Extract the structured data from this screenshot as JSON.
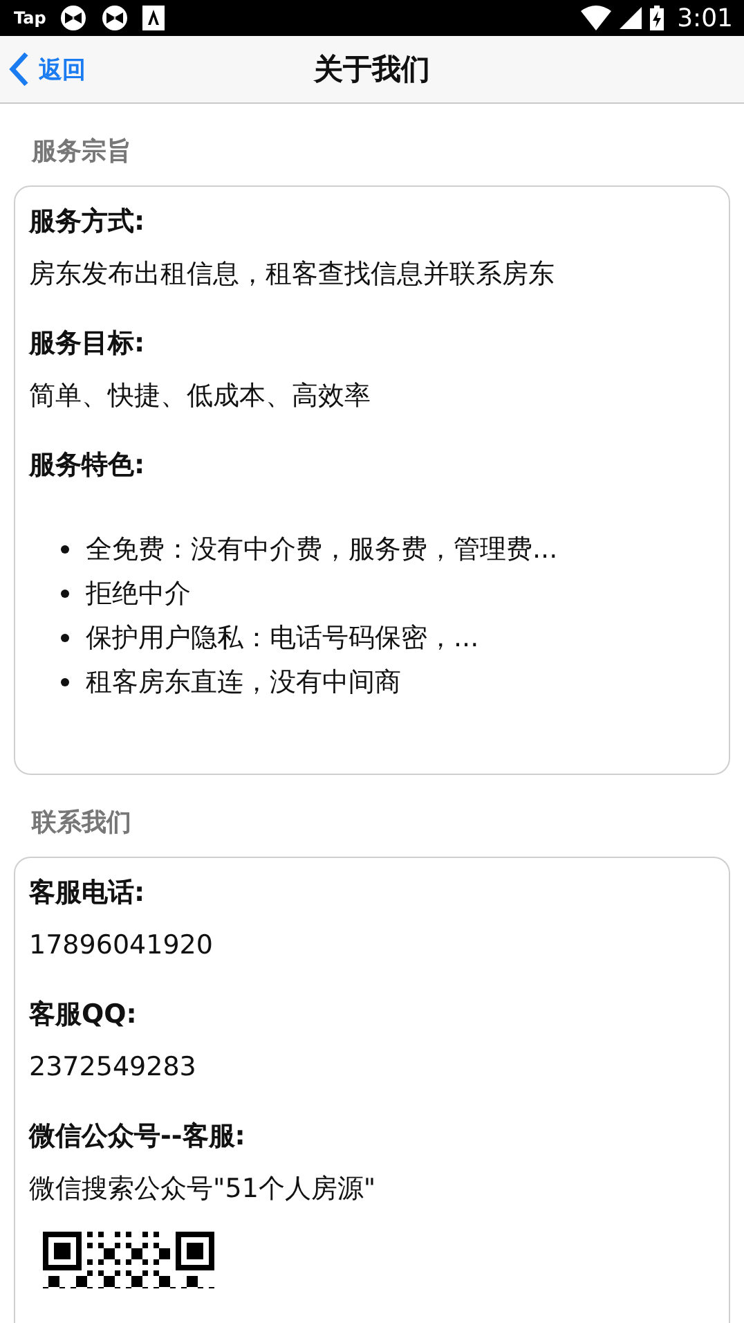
{
  "status_bar": {
    "app_label": "Tap",
    "time": "3:01"
  },
  "header": {
    "back": "返回",
    "title": "关于我们"
  },
  "sections": [
    {
      "title": "服务宗旨",
      "blocks": [
        {
          "kind": "text",
          "label": "服务方式:",
          "text": "房东发布出租信息，租客查找信息并联系房东"
        },
        {
          "kind": "text",
          "label": "服务目标:",
          "text": "简单、快捷、低成本、高效率"
        },
        {
          "kind": "list",
          "label": "服务特色:",
          "items": [
            "全免费：没有中介费，服务费，管理费...",
            "拒绝中介",
            "保护用户隐私：电话号码保密，...",
            "租客房东直连，没有中间商"
          ]
        }
      ]
    },
    {
      "title": "联系我们",
      "blocks": [
        {
          "kind": "text",
          "label": "客服电话:",
          "text": "17896041920"
        },
        {
          "kind": "text",
          "label": "客服QQ:",
          "text": "2372549283"
        },
        {
          "kind": "text",
          "label": "微信公众号--客服:",
          "text": "微信搜索公众号\"51个人房源\""
        },
        {
          "kind": "qr_code"
        }
      ]
    }
  ]
}
